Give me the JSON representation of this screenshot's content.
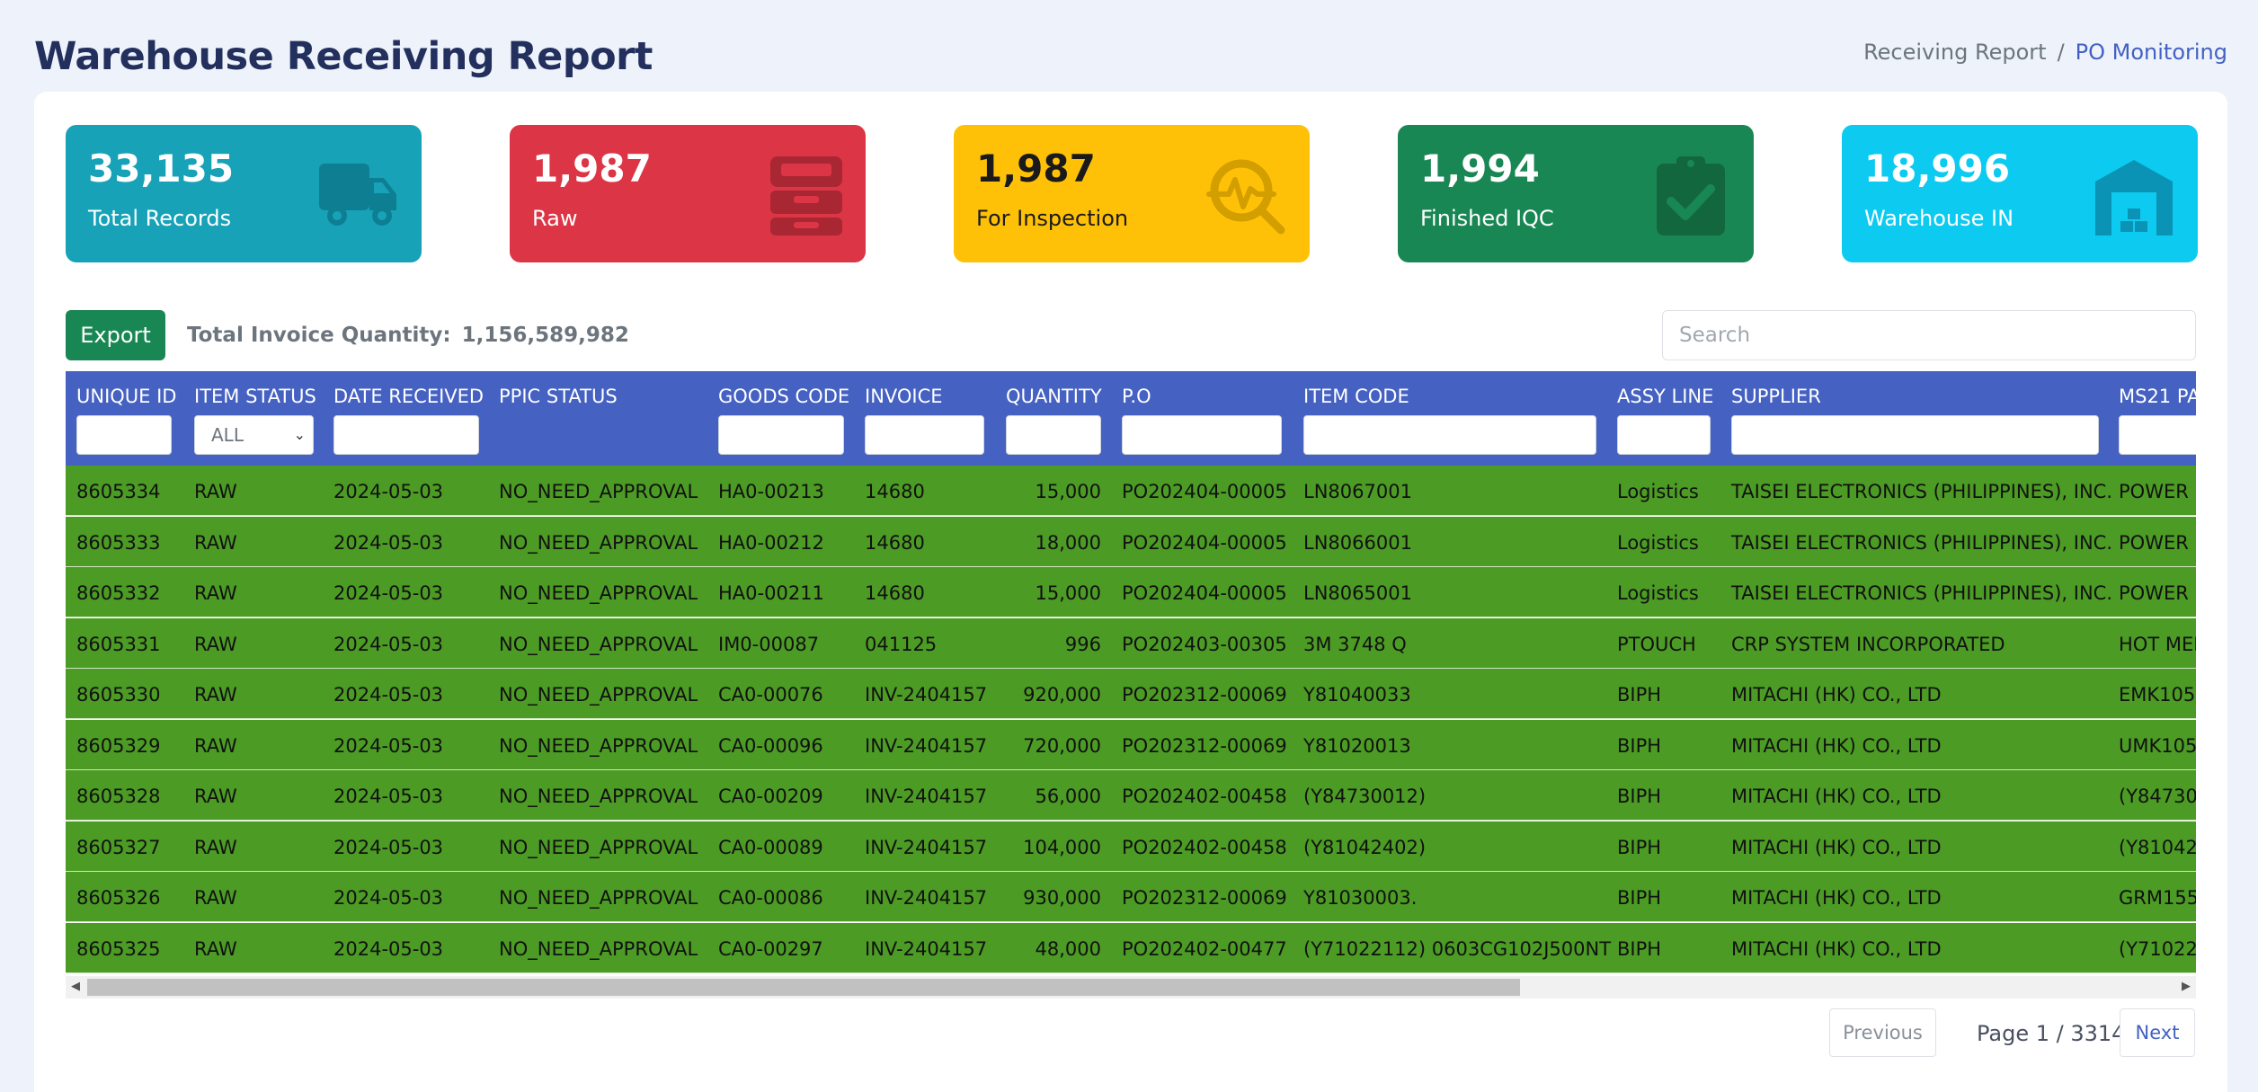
{
  "page": {
    "title": "Warehouse Receiving Report"
  },
  "breadcrumb": {
    "items": [
      "Receiving Report",
      "PO Monitoring"
    ],
    "separator": "/"
  },
  "stats": [
    {
      "value": "33,135",
      "label": "Total Records",
      "color": "#17a2b8",
      "icon": "truck-icon"
    },
    {
      "value": "1,987",
      "label": "Raw",
      "color": "#dc3545",
      "icon": "inbox-tray-icon"
    },
    {
      "value": "1,987",
      "label": "For Inspection",
      "color": "#ffc107",
      "icon": "inspection-magnifier-icon"
    },
    {
      "value": "1,994",
      "label": "Finished IQC",
      "color": "#198754",
      "icon": "clipboard-check-icon"
    },
    {
      "value": "18,996",
      "label": "Warehouse IN",
      "color": "#0dcaf0",
      "icon": "warehouse-icon"
    }
  ],
  "toolbar": {
    "export_label": "Export",
    "total_invoice_label": "Total Invoice Quantity:",
    "total_invoice_value": "1,156,589,982",
    "search_placeholder": "Search"
  },
  "table": {
    "columns": [
      "UNIQUE ID",
      "ITEM STATUS",
      "DATE RECEIVED",
      "PPIC STATUS",
      "GOODS CODE",
      "INVOICE",
      "QUANTITY",
      "P.O",
      "ITEM CODE",
      "ASSY LINE",
      "SUPPLIER",
      "MS21 PA"
    ],
    "status_filter_value": "ALL",
    "row_color": "#4c9b24",
    "header_color": "#4561c2",
    "rows": [
      [
        "8605334",
        "RAW",
        "2024-05-03",
        "NO_NEED_APPROVAL",
        "HA0-00213",
        "14680",
        "15,000",
        "PO202404-00005",
        "LN8067001",
        "Logistics",
        "TAISEI ELECTRONICS (PHILIPPINES), INC.",
        "POWER"
      ],
      [
        "8605333",
        "RAW",
        "2024-05-03",
        "NO_NEED_APPROVAL",
        "HA0-00212",
        "14680",
        "18,000",
        "PO202404-00005",
        "LN8066001",
        "Logistics",
        "TAISEI ELECTRONICS (PHILIPPINES), INC.",
        "POWER"
      ],
      [
        "8605332",
        "RAW",
        "2024-05-03",
        "NO_NEED_APPROVAL",
        "HA0-00211",
        "14680",
        "15,000",
        "PO202404-00005",
        "LN8065001",
        "Logistics",
        "TAISEI ELECTRONICS (PHILIPPINES), INC.",
        "POWER"
      ],
      [
        "8605331",
        "RAW",
        "2024-05-03",
        "NO_NEED_APPROVAL",
        "IM0-00087",
        "041125",
        "996",
        "PO202403-00305",
        "3M 3748 Q",
        "PTOUCH",
        "CRP SYSTEM INCORPORATED",
        "HOT MEI"
      ],
      [
        "8605330",
        "RAW",
        "2024-05-03",
        "NO_NEED_APPROVAL",
        "CA0-00076",
        "INV-2404157",
        "920,000",
        "PO202312-00069",
        "Y81040033",
        "BIPH",
        "MITACHI (HK) CO., LTD",
        "EMK105"
      ],
      [
        "8605329",
        "RAW",
        "2024-05-03",
        "NO_NEED_APPROVAL",
        "CA0-00096",
        "INV-2404157",
        "720,000",
        "PO202312-00069",
        "Y81020013",
        "BIPH",
        "MITACHI (HK) CO., LTD",
        "UMK105"
      ],
      [
        "8605328",
        "RAW",
        "2024-05-03",
        "NO_NEED_APPROVAL",
        "CA0-00209",
        "INV-2404157",
        "56,000",
        "PO202402-00458",
        "(Y84730012)",
        "BIPH",
        "MITACHI (HK) CO., LTD",
        "(Y84730"
      ],
      [
        "8605327",
        "RAW",
        "2024-05-03",
        "NO_NEED_APPROVAL",
        "CA0-00089",
        "INV-2404157",
        "104,000",
        "PO202402-00458",
        "(Y81042402)",
        "BIPH",
        "MITACHI (HK) CO., LTD",
        "(Y81042"
      ],
      [
        "8605326",
        "RAW",
        "2024-05-03",
        "NO_NEED_APPROVAL",
        "CA0-00086",
        "INV-2404157",
        "930,000",
        "PO202312-00069",
        "Y81030003.",
        "BIPH",
        "MITACHI (HK) CO., LTD",
        "GRM155"
      ],
      [
        "8605325",
        "RAW",
        "2024-05-03",
        "NO_NEED_APPROVAL",
        "CA0-00297",
        "INV-2404157",
        "48,000",
        "PO202402-00477",
        "(Y71022112) 0603CG102J500NT",
        "BIPH",
        "MITACHI (HK) CO., LTD",
        "(Y71022"
      ]
    ]
  },
  "pagination": {
    "previous_label": "Previous",
    "page_info": "Page 1 / 3314",
    "next_label": "Next"
  }
}
